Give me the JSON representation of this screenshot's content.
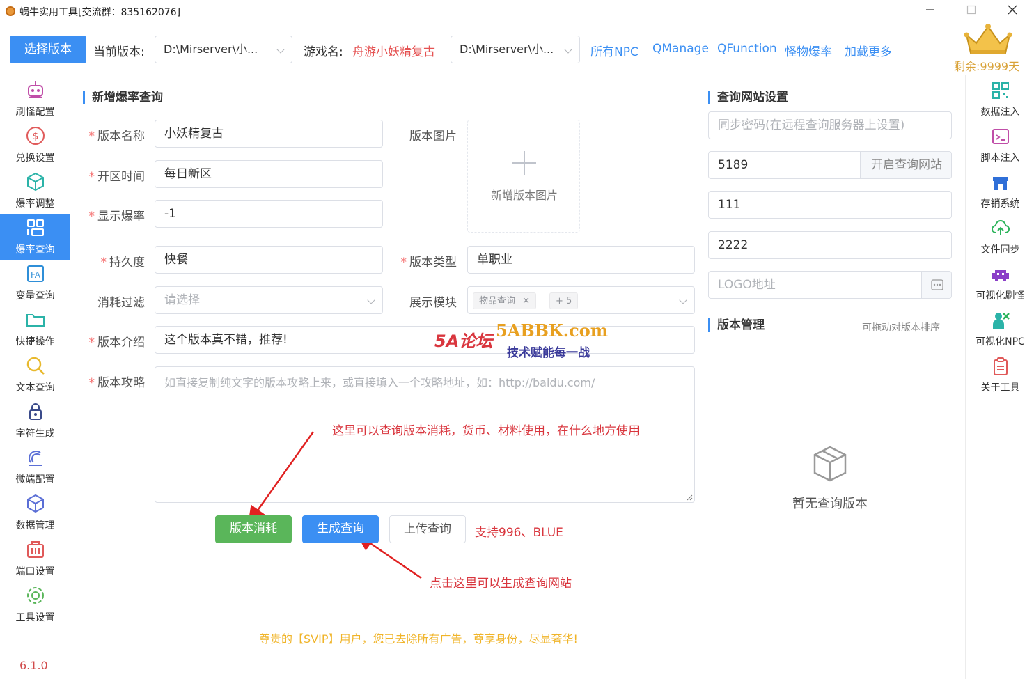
{
  "window": {
    "title": "蜗牛实用工具[交流群：835162076]",
    "min_icon": "minimize-icon",
    "max_icon": "maximize-icon",
    "close_icon": "close-icon"
  },
  "toolbar": {
    "select_version_label": "选择版本",
    "current_version_label": "当前版本:",
    "current_version_value": "D:\\Mirserver\\小...",
    "game_name_label": "游戏名:",
    "game_name_value": "舟游小妖精复古",
    "second_path_value": "D:\\Mirserver\\小...",
    "links": [
      "所有NPC",
      "QManage",
      "QFunction",
      "怪物爆率",
      "加载更多"
    ],
    "remaining": "剩余:9999天",
    "crown_icon": "crown-icon"
  },
  "left_nav": {
    "active_index": 3,
    "items": [
      {
        "label": "刷怪配置",
        "icon": "robot-icon"
      },
      {
        "label": "兑换设置",
        "icon": "dollar-icon"
      },
      {
        "label": "爆率调整",
        "icon": "cube-icon"
      },
      {
        "label": "爆率查询",
        "icon": "layout-icon"
      },
      {
        "label": "变量查询",
        "icon": "variable-icon"
      },
      {
        "label": "快捷操作",
        "icon": "folder-icon"
      },
      {
        "label": "文本查询",
        "icon": "search-icon"
      },
      {
        "label": "字符生成",
        "icon": "lock-icon"
      },
      {
        "label": "微端配置",
        "icon": "satellite-icon"
      },
      {
        "label": "数据管理",
        "icon": "box-icon"
      },
      {
        "label": "端口设置",
        "icon": "port-icon"
      },
      {
        "label": "工具设置",
        "icon": "gear-icon"
      }
    ],
    "version": "6.1.0"
  },
  "right_nav": {
    "items": [
      {
        "label": "数据注入",
        "icon": "qrcode-icon"
      },
      {
        "label": "脚本注入",
        "icon": "terminal-icon"
      },
      {
        "label": "存销系统",
        "icon": "store-icon"
      },
      {
        "label": "文件同步",
        "icon": "cloud-sync-icon"
      },
      {
        "label": "可视化刷怪",
        "icon": "invader-icon"
      },
      {
        "label": "可视化NPC",
        "icon": "npc-icon"
      },
      {
        "label": "关于工具",
        "icon": "clipboard-icon"
      }
    ]
  },
  "form": {
    "section_title": "新增爆率查询",
    "version_name_label": "版本名称",
    "version_name_value": "小妖精复古",
    "open_time_label": "开区时间",
    "open_time_value": "每日新区",
    "show_rate_label": "显示爆率",
    "show_rate_value": "-1",
    "version_image_label": "版本图片",
    "add_image_label": "新增版本图片",
    "durability_label": "持久度",
    "durability_value": "快餐",
    "version_type_label": "版本类型",
    "version_type_value": "单职业",
    "consume_filter_label": "消耗过滤",
    "consume_filter_placeholder": "请选择",
    "display_module_label": "展示模块",
    "display_module_tag": "物品查询",
    "display_module_more": "+ 5",
    "intro_label": "版本介绍",
    "intro_value": "这个版本真不错，推荐!",
    "strategy_label": "版本攻略",
    "strategy_placeholder": "如直接复制纯文字的版本攻略上来，或直接填入一个攻略地址，如：http://baidu.com/",
    "annotation_top": "这里可以查询版本消耗，货币、材料使用，在什么地方使用",
    "btn_consume": "版本消耗",
    "btn_generate": "生成查询",
    "btn_upload": "上传查询",
    "support_text": "支持996、BLUE",
    "annotation_bottom": "点击这里可以生成查询网站"
  },
  "query_site": {
    "section_title": "查询网站设置",
    "sync_password_placeholder": "同步密码(在远程查询服务器上设置)",
    "port_value": "5189",
    "open_site_button": "开启查询网站",
    "field_1": "111",
    "field_2": "2222",
    "logo_placeholder": "LOGO地址",
    "more_icon": "ellipsis-icon"
  },
  "version_mgmt": {
    "section_title": "版本管理",
    "hint": "可拖动对版本排序",
    "empty_text": "暂无查询版本",
    "empty_icon": "empty-box-icon"
  },
  "watermark": {
    "logo_main": "5A论坛",
    "logo_site": "5ABBK.com",
    "logo_slogan": "技术赋能每一战"
  },
  "banner": {
    "text": "尊贵的【SVIP】用户，您已去除所有广告，尊享身份，尽显奢华!"
  },
  "colors": {
    "primary": "#3b8ff3",
    "success": "#5ab65a",
    "danger": "#d9363e",
    "gold": "#f0b429"
  }
}
